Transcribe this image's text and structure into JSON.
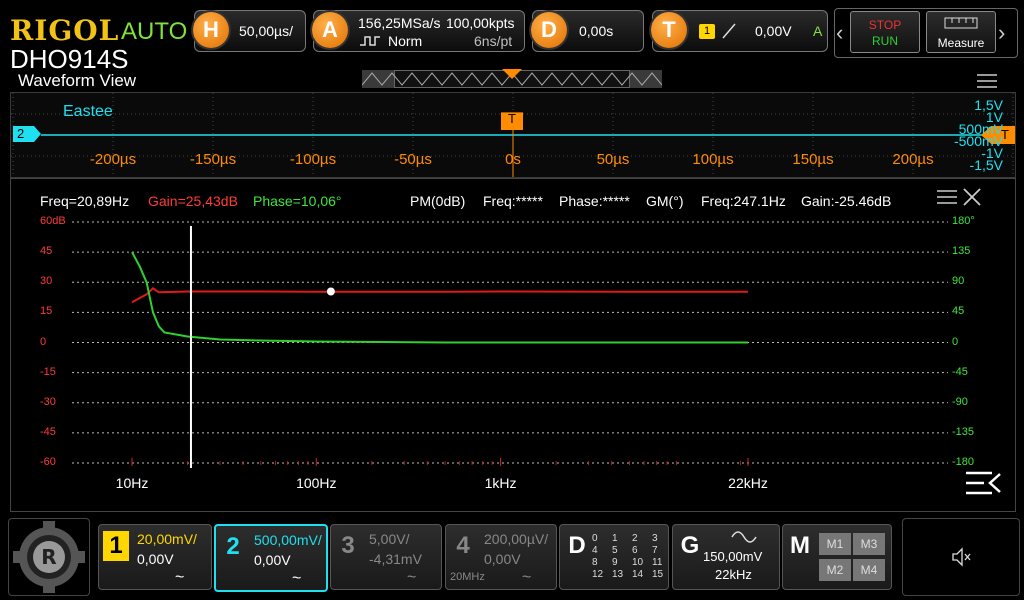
{
  "top": {
    "brand": "RIGOL",
    "trigger_mode": "AUTO",
    "model": "DHO914S",
    "horizontal": {
      "badge": "H",
      "timebase": "50,00µs/"
    },
    "acquire": {
      "badge": "A",
      "sample_rate": "156,25MSa/s",
      "memory": "100,00kpts",
      "mode": "Norm",
      "resolution": "6ns/pt"
    },
    "delay": {
      "badge": "D",
      "value": "0,00s"
    },
    "trigger": {
      "badge": "T",
      "source": "1",
      "level": "0,00V",
      "mode_letter": "A"
    },
    "stop_label": "STOP",
    "run_label": "RUN",
    "measure_label": "Measure"
  },
  "waveform_view": {
    "title": "Waveform View",
    "channel_marker": "2",
    "trigger_marker": "T",
    "overlay_label": "Eastee",
    "time_ticks": [
      "-200µs",
      "-150µs",
      "-100µs",
      "-50µs",
      "0s",
      "50µs",
      "100µs",
      "150µs",
      "200µs"
    ],
    "right_labels": [
      "1,5V",
      "1V",
      "500mV",
      "-500mV",
      "-1V",
      "-1,5V"
    ]
  },
  "bode": {
    "cursor_freq": "Freq=20,89Hz",
    "cursor_gain": "Gain=25,43dB",
    "cursor_phase": "Phase=10,06°",
    "pm_label": "PM(0dB)",
    "pm_freq": "Freq:*****",
    "pm_phase": "Phase:*****",
    "gm_label": "GM(°)",
    "gm_freq": "Freq:247.1Hz",
    "gm_gain": "Gain:-25.46dB"
  },
  "colors": {
    "gain": "#e01a1a",
    "phase": "#2fd02f",
    "accent": "#ff8c00",
    "ch1": "#ffd700",
    "ch2": "#1ee0f0"
  },
  "chart_data": {
    "type": "line",
    "x_scale": "log",
    "xlim": [
      10,
      22000
    ],
    "x_tick_labels": [
      "10Hz",
      "100Hz",
      "1kHz",
      "22kHz"
    ],
    "x_tick_values": [
      10,
      100,
      1000,
      22000
    ],
    "y_left_label": "60dB",
    "y_left_ticks": [
      "60dB",
      "45",
      "30",
      "15",
      "0",
      "-15",
      "-30",
      "-45",
      "-60"
    ],
    "ylim_left": [
      -60,
      60
    ],
    "y_right_ticks": [
      "180°",
      "135",
      "90",
      "45",
      "0",
      "-45",
      "-90",
      "-135",
      "-180"
    ],
    "ylim_right": [
      -180,
      180
    ],
    "grid": true,
    "cursor_x": 20.89,
    "series": [
      {
        "color": "#e01a1a",
        "axis": "left",
        "x": [
          10,
          12,
          13,
          14,
          20,
          50,
          100,
          500,
          1000,
          5000,
          10000,
          22000
        ],
        "y": [
          20,
          24,
          27,
          25,
          25.4,
          25.4,
          25.3,
          25.3,
          25.4,
          25.3,
          25.3,
          25.3
        ]
      },
      {
        "color": "#2fd02f",
        "axis": "left",
        "x": [
          10,
          11,
          12,
          13,
          14,
          15,
          20,
          30,
          50,
          100,
          500,
          1000,
          5000,
          10000,
          22000
        ],
        "y": [
          45,
          38,
          30,
          15,
          8,
          5,
          3,
          1.5,
          1,
          0.5,
          0,
          0,
          0,
          0,
          0
        ]
      }
    ],
    "marker_point": {
      "x": 120,
      "y": 25.4
    }
  },
  "bottom": {
    "channels": [
      {
        "num": "1",
        "scale": "20,00mV/",
        "offset": "0,00V",
        "coupling": "~"
      },
      {
        "num": "2",
        "scale": "500,00mV/",
        "offset": "0,00V",
        "coupling": "~"
      },
      {
        "num": "3",
        "scale": "5,00V/",
        "offset": "-4,31mV",
        "coupling": "~"
      },
      {
        "num": "4",
        "scale": "200,00µV/",
        "offset": "0,00V",
        "coupling": "~",
        "bandwidth": "20MHz"
      }
    ],
    "digital": {
      "label": "D",
      "channels": [
        "0",
        "1",
        "2",
        "3",
        "4",
        "5",
        "6",
        "7",
        "8",
        "9",
        "10",
        "11",
        "12",
        "13",
        "14",
        "15"
      ]
    },
    "generator": {
      "label": "G",
      "amplitude": "150,00mV",
      "frequency": "22kHz"
    },
    "math": {
      "label": "M",
      "items": [
        "M1",
        "M3",
        "M2",
        "M4"
      ]
    }
  }
}
